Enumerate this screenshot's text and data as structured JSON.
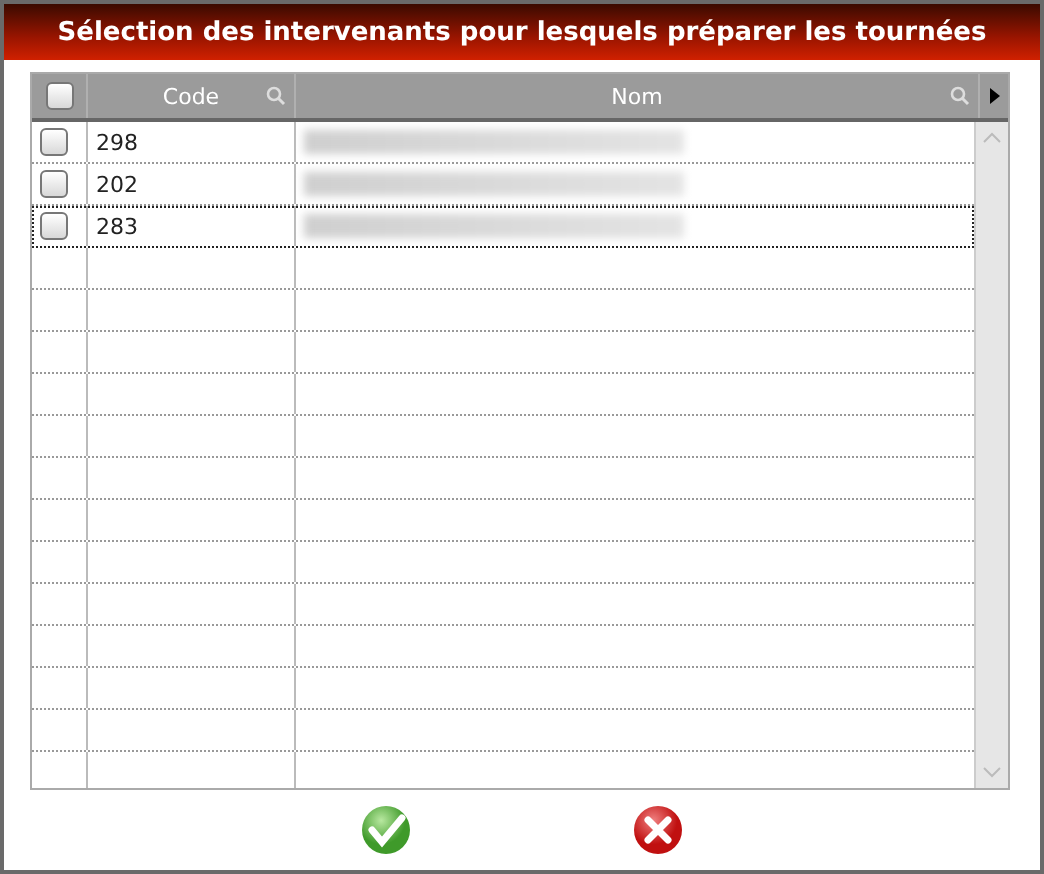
{
  "window": {
    "title": "Sélection des intervenants pour lesquels préparer les tournées"
  },
  "header": {
    "select_all_checked": false,
    "columns": [
      "Code",
      "Nom"
    ]
  },
  "rows": [
    {
      "checked": false,
      "code": "298",
      "name_blurred": true,
      "focused": false
    },
    {
      "checked": false,
      "code": "202",
      "name_blurred": true,
      "focused": false
    },
    {
      "checked": false,
      "code": "283",
      "name_blurred": true,
      "focused": true
    }
  ]
}
